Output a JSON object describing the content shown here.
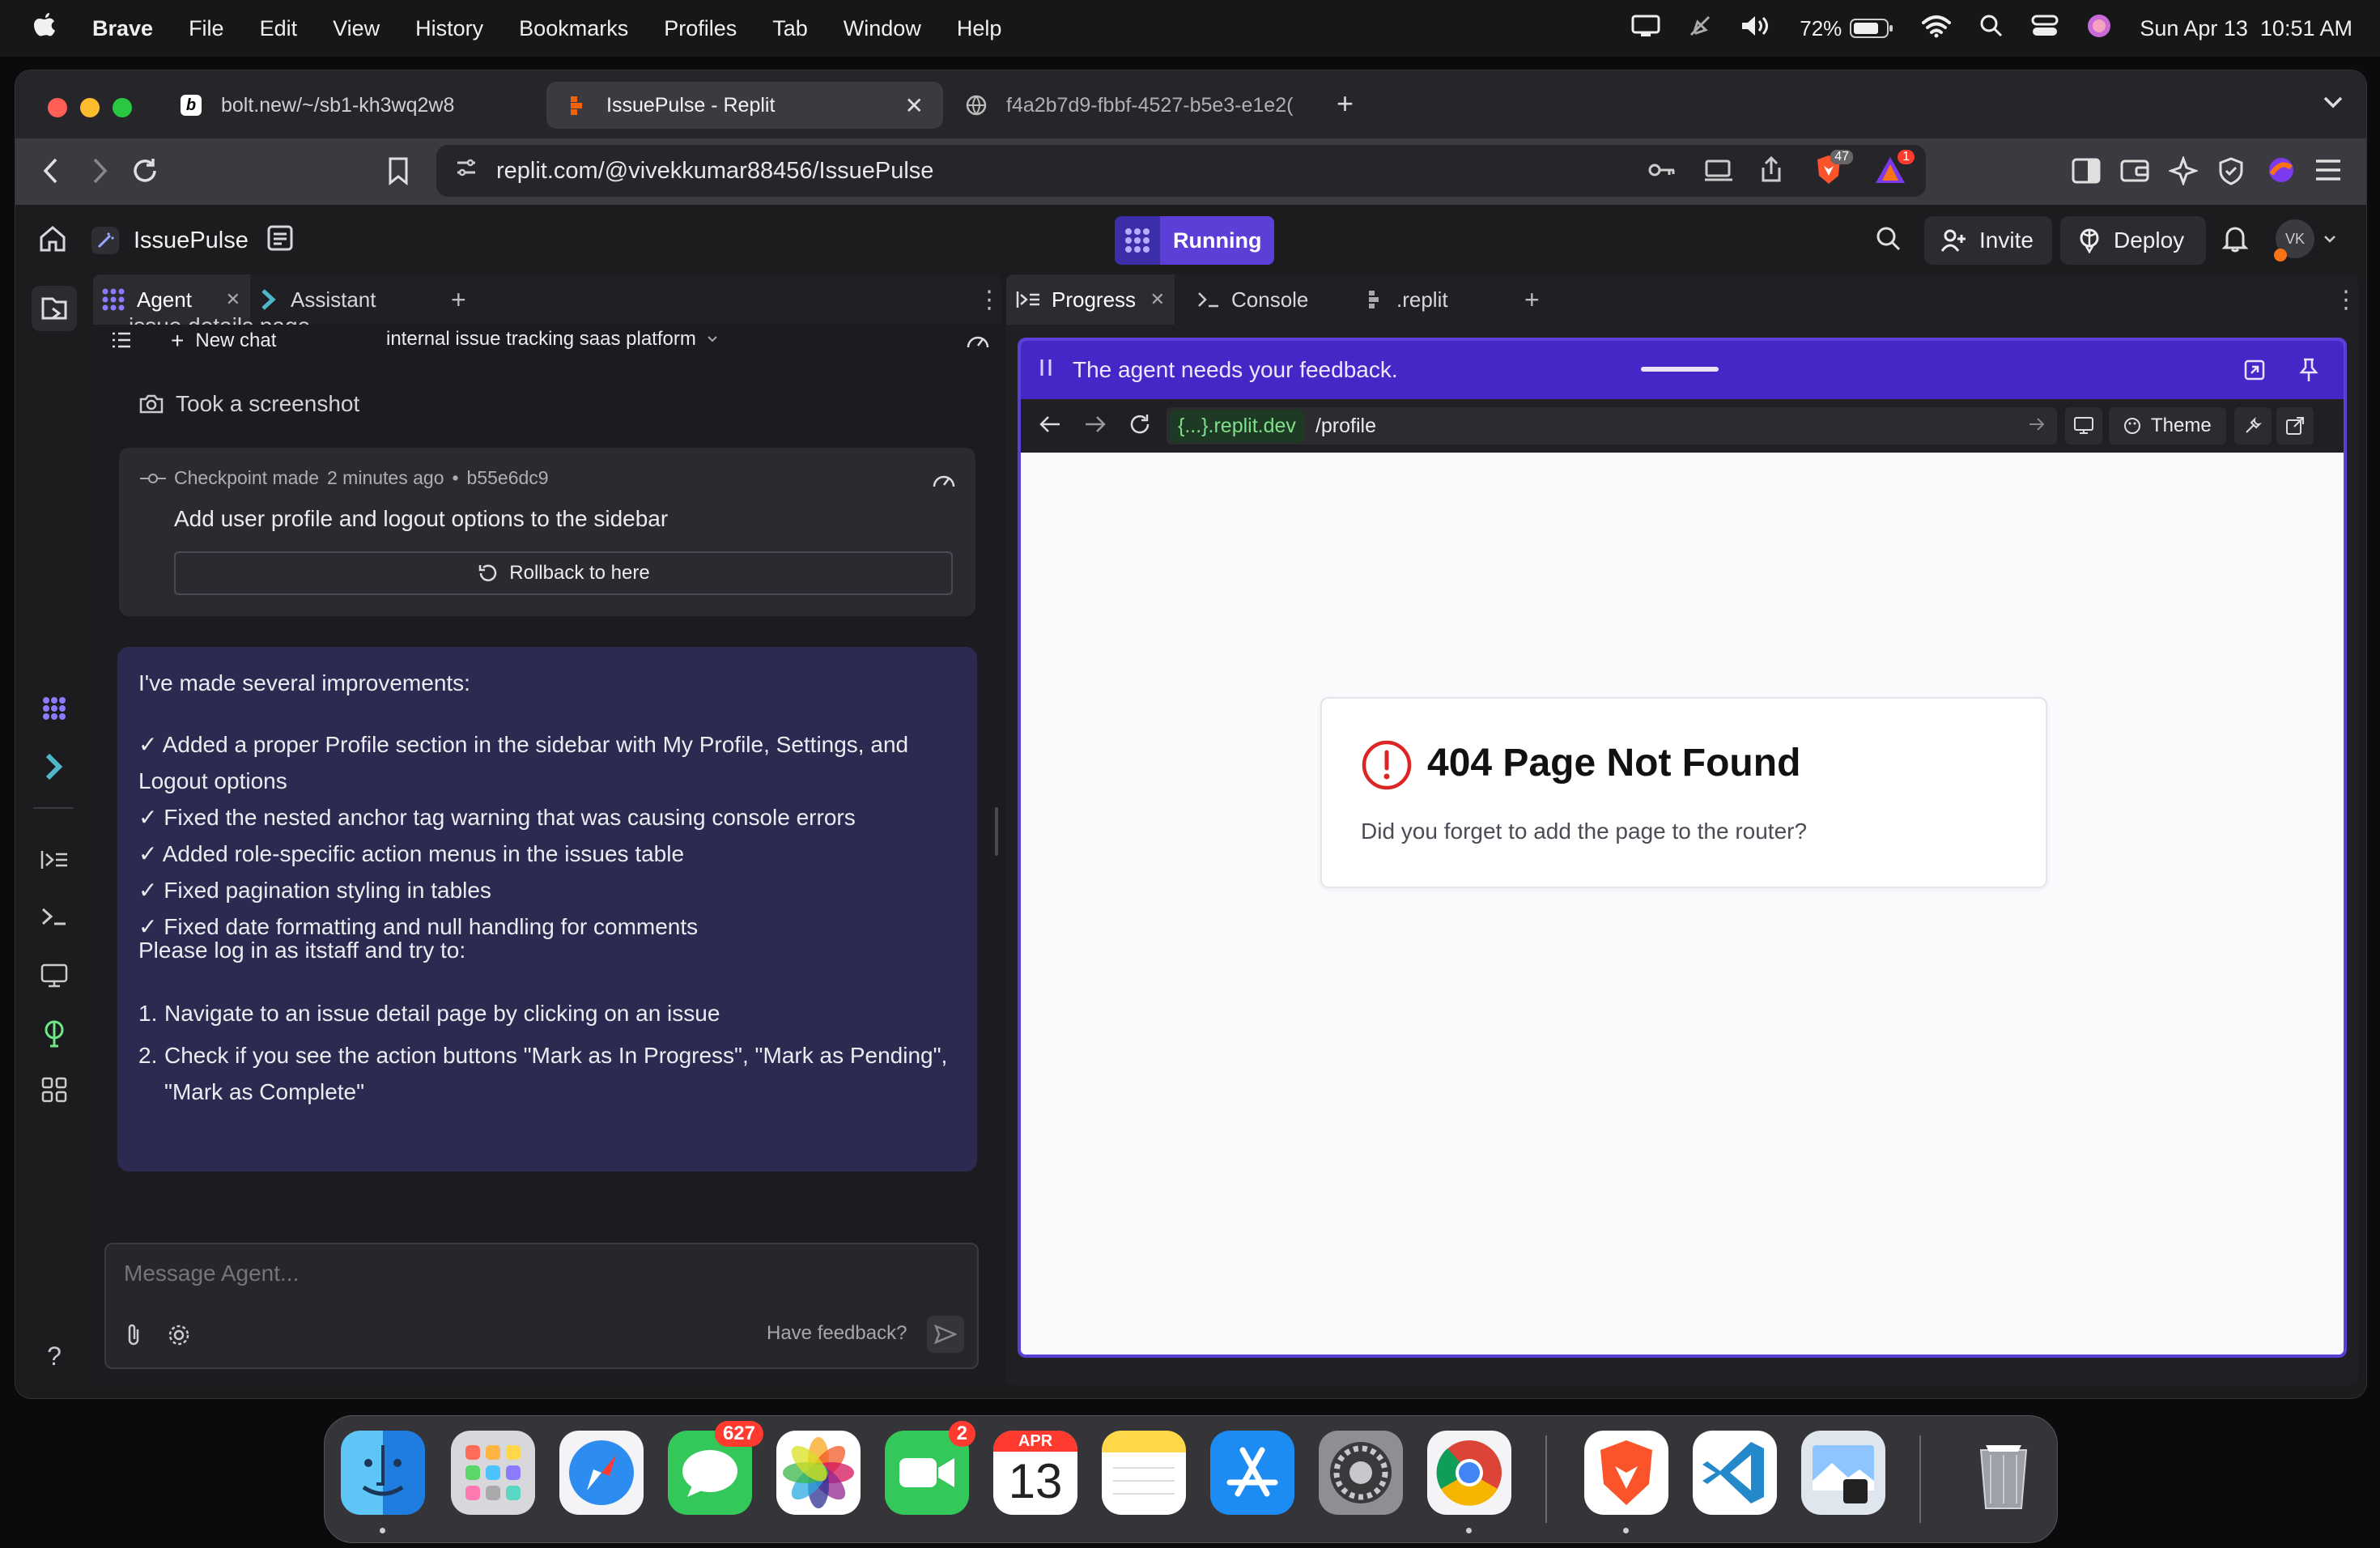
{
  "menubar": {
    "apple": "",
    "items": [
      "Brave",
      "File",
      "Edit",
      "View",
      "History",
      "Bookmarks",
      "Profiles",
      "Tab",
      "Window",
      "Help"
    ],
    "battery": "72%",
    "datetime": "Sun Apr 13  10:51 AM"
  },
  "browser": {
    "tabs": [
      {
        "label": "bolt.new/~/sb1-kh3wq2w8",
        "icon": "bolt-icon"
      },
      {
        "label": "IssuePulse - Replit",
        "icon": "replit-icon",
        "active": true
      },
      {
        "label": "f4a2b7d9-fbbf-4527-b5e3-e1e2(",
        "icon": "globe-icon"
      }
    ],
    "url": "replit.com/@vivekkumar88456/IssuePulse",
    "shields_count": "47",
    "alert_count": "1"
  },
  "replit_header": {
    "project_name": "IssuePulse",
    "run_status": "Running",
    "invite_label": "Invite",
    "deploy_label": "Deploy",
    "avatar_initials": "VK"
  },
  "agent_panel": {
    "tabs": [
      {
        "label": "Agent"
      },
      {
        "label": "Assistant"
      }
    ],
    "new_chat_label": "New chat",
    "chat_title": "internal issue tracking saas platform",
    "cut_off_text": "issue details page.",
    "screenshot_label": "Took a screenshot",
    "checkpoint": {
      "label": "Checkpoint made",
      "time": "2 minutes ago",
      "separator": "•",
      "hash": "b55e6dc9",
      "description": "Add user profile and logout options to the sidebar",
      "rollback_label": "Rollback to here"
    },
    "message": {
      "intro": "I've made several improvements:",
      "checks": [
        "✓ Added a proper Profile section in the sidebar with My Profile, Settings, and Logout options",
        "✓ Fixed the nested anchor tag warning that was causing console errors",
        "✓ Added role-specific action menus in the issues table",
        "✓ Fixed pagination styling in tables",
        "✓ Fixed date formatting and null handling for comments"
      ],
      "instruction": "Please log in as itstaff and try to:",
      "steps": [
        {
          "num": "1.",
          "text": "Navigate to an issue detail page by clicking on an issue"
        },
        {
          "num": "2.",
          "text": "Check if you see the action buttons \"Mark as In Progress\", \"Mark as Pending\", \"Mark as Complete\""
        }
      ]
    },
    "input_placeholder": "Message Agent...",
    "feedback_label": "Have feedback?"
  },
  "right_panel": {
    "tabs": [
      {
        "label": "Progress"
      },
      {
        "label": "Console"
      },
      {
        "label": ".replit"
      }
    ],
    "feedback_banner": "The agent needs your feedback.",
    "preview_domain": "{...}.replit.dev",
    "preview_path": "/profile",
    "theme_label": "Theme",
    "error_title": "404 Page Not Found",
    "error_message": "Did you forget to add the page to the router?"
  },
  "dock": {
    "messages_badge": "627",
    "facetime_badge": "2",
    "calendar_month": "APR",
    "calendar_day": "13"
  },
  "colors": {
    "accent_purple": "#5b3fd6",
    "feedback_bar": "#4527c8",
    "message_bubble": "#2d2a52",
    "error_red": "#dc2626",
    "domain_green": "#7ee08a"
  }
}
